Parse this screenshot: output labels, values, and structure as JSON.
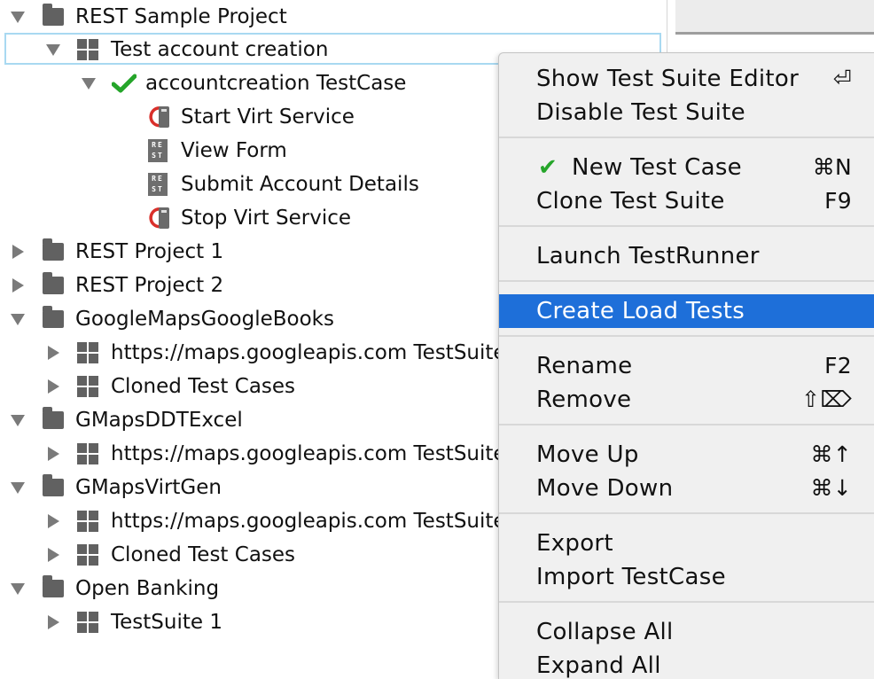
{
  "tree": {
    "rows": [
      {
        "label": "REST Sample Project",
        "arrow": "down",
        "icon": "folder",
        "level": 0
      },
      {
        "label": "Test account creation",
        "arrow": "down",
        "icon": "suite",
        "level": 1
      },
      {
        "label": "accountcreation TestCase",
        "arrow": "down",
        "icon": "check",
        "level": 2
      },
      {
        "label": "Start Virt Service",
        "arrow": "none",
        "icon": "virt",
        "level": 3
      },
      {
        "label": "View Form",
        "arrow": "none",
        "icon": "rest",
        "level": 3
      },
      {
        "label": "Submit Account Details",
        "arrow": "none",
        "icon": "rest",
        "level": 3
      },
      {
        "label": "Stop Virt Service",
        "arrow": "none",
        "icon": "virt",
        "level": 3
      },
      {
        "label": "REST Project 1",
        "arrow": "right",
        "icon": "folder",
        "level": 0
      },
      {
        "label": "REST Project 2",
        "arrow": "right",
        "icon": "folder",
        "level": 0
      },
      {
        "label": "GoogleMapsGoogleBooks",
        "arrow": "down",
        "icon": "folder",
        "level": 0
      },
      {
        "label": "https://maps.googleapis.com TestSuite",
        "arrow": "right",
        "icon": "suite",
        "level": 1
      },
      {
        "label": "Cloned Test Cases",
        "arrow": "right",
        "icon": "suite",
        "level": 1
      },
      {
        "label": "GMapsDDTExcel",
        "arrow": "down",
        "icon": "folder",
        "level": 0
      },
      {
        "label": "https://maps.googleapis.com TestSuite",
        "arrow": "right",
        "icon": "suite",
        "level": 1
      },
      {
        "label": "GMapsVirtGen",
        "arrow": "down",
        "icon": "folder",
        "level": 0
      },
      {
        "label": "https://maps.googleapis.com TestSuite",
        "arrow": "right",
        "icon": "suite",
        "level": 1
      },
      {
        "label": "Cloned Test Cases",
        "arrow": "right",
        "icon": "suite",
        "level": 1
      },
      {
        "label": "Open Banking",
        "arrow": "down",
        "icon": "folder",
        "level": 0
      },
      {
        "label": "TestSuite 1",
        "arrow": "right",
        "icon": "suite",
        "level": 1
      }
    ],
    "rest_icon_text": "RE ST"
  },
  "menu": {
    "items": [
      {
        "label": "Show Test Suite Editor",
        "shortcut": "⏎"
      },
      {
        "label": "Disable Test Suite",
        "shortcut": ""
      },
      {
        "label": "New Test Case",
        "shortcut": "⌘N",
        "check": "✔"
      },
      {
        "label": "Clone Test Suite",
        "shortcut": "F9"
      },
      {
        "label": "Launch TestRunner",
        "shortcut": ""
      },
      {
        "label": "Create Load Tests",
        "shortcut": ""
      },
      {
        "label": "Rename",
        "shortcut": "F2"
      },
      {
        "label": "Remove",
        "shortcut": "⇧⌦"
      },
      {
        "label": "Move Up",
        "shortcut": "⌘↑"
      },
      {
        "label": "Move Down",
        "shortcut": "⌘↓"
      },
      {
        "label": "Export",
        "shortcut": ""
      },
      {
        "label": "Import TestCase",
        "shortcut": ""
      },
      {
        "label": "Collapse All",
        "shortcut": ""
      },
      {
        "label": "Expand All",
        "shortcut": ""
      }
    ]
  },
  "colors": {
    "highlight": "#1e6fd9",
    "check": "#25a52a",
    "icon_gray": "#616161",
    "virt_red": "#d9302b"
  }
}
